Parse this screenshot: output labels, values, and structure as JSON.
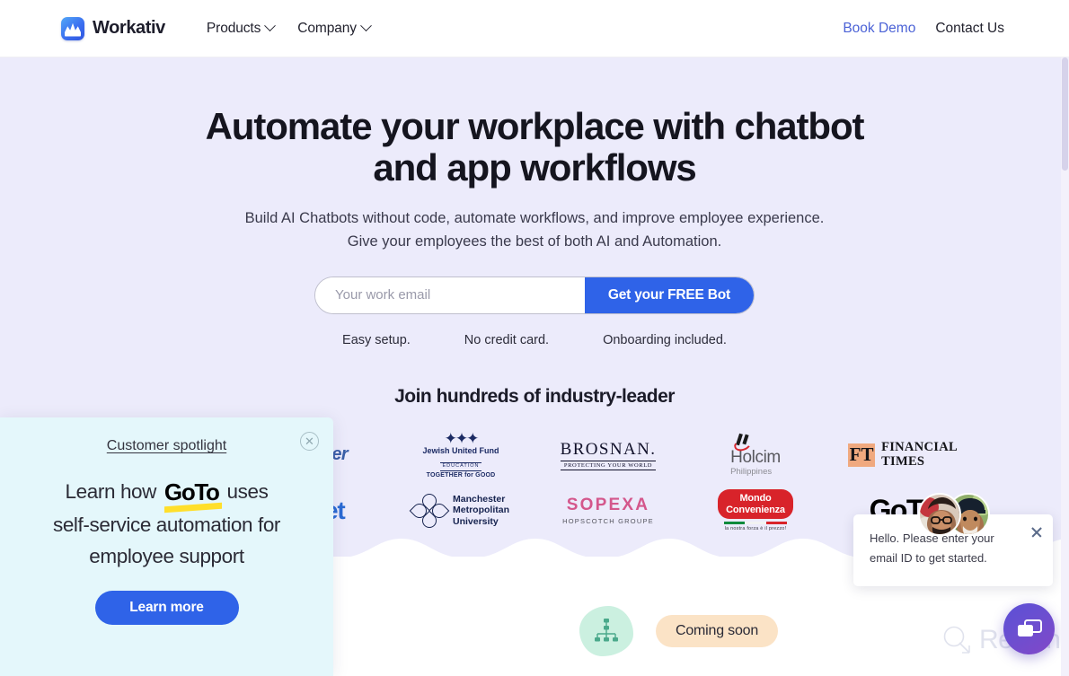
{
  "header": {
    "brand_name": "Workativ",
    "brand_icon": "workativ-logo-icon",
    "nav": [
      {
        "label": "Products",
        "icon": "chevron-down-icon"
      },
      {
        "label": "Company",
        "icon": "chevron-down-icon"
      }
    ],
    "book_demo": "Book Demo",
    "contact_us": "Contact Us"
  },
  "hero": {
    "heading_line1": "Automate your workplace with chatbot",
    "heading_line2": "and app workflows",
    "sub_line1": "Build AI Chatbots without code, automate workflows, and improve employee experience.",
    "sub_line2": "Give your employees the best of both AI and Automation.",
    "email_placeholder": "Your work email",
    "email_value": "",
    "cta_label": "Get your FREE Bot",
    "perks": [
      "Easy setup.",
      "No credit card.",
      "Onboarding included."
    ],
    "bg_color": "#ecebfb",
    "cta_color": "#2f63e8"
  },
  "logos": {
    "title": "Join hundreds of industry-leader",
    "row1": [
      {
        "name": "hidden-logo",
        "label": ""
      },
      {
        "name": "hammer",
        "label": "Hammer"
      },
      {
        "name": "jewish-united-fund",
        "label": "Jewish United Fund",
        "line2": "EDUCATION",
        "line3": "TOGETHER for GOOD"
      },
      {
        "name": "brosnan",
        "label": "BROSNAN.",
        "line2": "PROTECTING YOUR WORLD"
      },
      {
        "name": "holcim",
        "label": "Holcim",
        "line2": "Philippines"
      },
      {
        "name": "financial-times",
        "label": "FT",
        "line2": "FINANCIAL",
        "line3": "TIMES"
      }
    ],
    "row2": [
      {
        "name": "hidden-logo-2",
        "label": ""
      },
      {
        "name": "ufinet",
        "label": "ufinet"
      },
      {
        "name": "manchester-metropolitan-university",
        "label": "Manchester",
        "line2": "Metropolitan",
        "line3": "University"
      },
      {
        "name": "sopexa",
        "label": "SOPEXA",
        "line2": "HOPSCOTCH GROUPE"
      },
      {
        "name": "mondo-convenienza",
        "label": "Mondo",
        "line2": "Convenienza",
        "line3": "la nostra forza è il prezzo!"
      },
      {
        "name": "goto",
        "label": "GoTo"
      }
    ]
  },
  "below": {
    "coming_soon": "Coming soon",
    "blob_icon": "org-chart-icon",
    "chip_color": "#fbe3c6"
  },
  "spotlight": {
    "title": "Customer spotlight",
    "close_icon": "close-circle-icon",
    "text_before": "Learn how",
    "brand": "GoTo",
    "text_after": "uses",
    "line2": "self-service automation for",
    "line3": "employee support",
    "button": "Learn more",
    "bg_color": "#e4f7fb",
    "button_color": "#2f63e8"
  },
  "chat": {
    "message": "Hello. Please enter your email ID to get started.",
    "close_icon": "close-icon",
    "avatar_1": "agent-avatar-1",
    "avatar_2": "agent-avatar-2",
    "fab_icon": "chat-bubbles-icon"
  },
  "watermark": {
    "text": "Revain",
    "icon": "revain-logo-icon"
  }
}
